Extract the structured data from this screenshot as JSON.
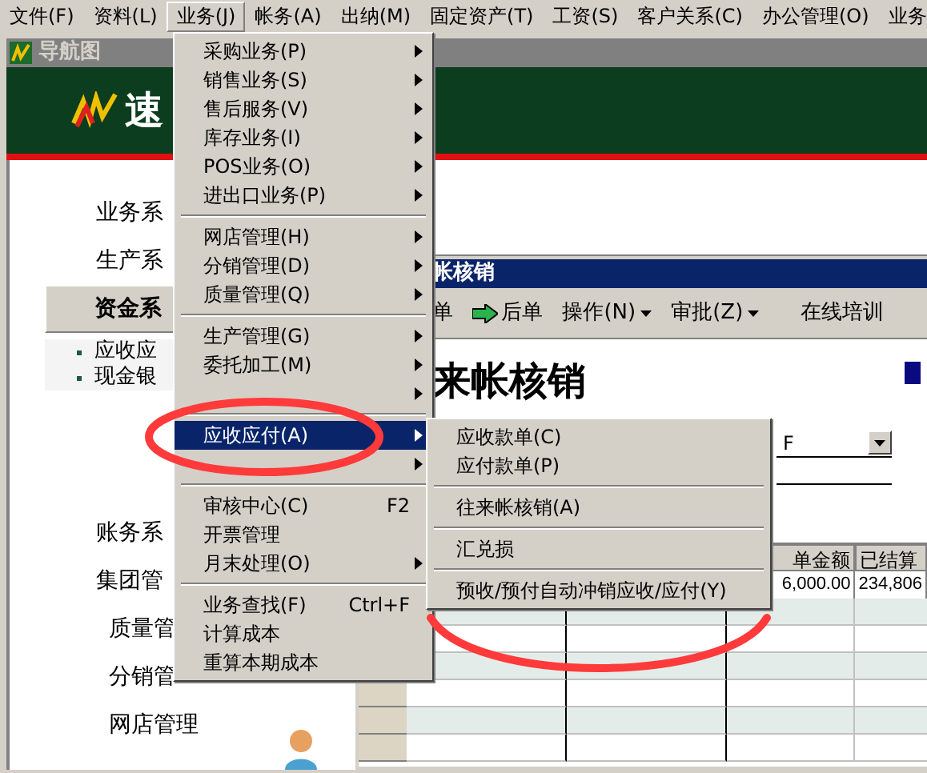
{
  "menubar": [
    {
      "label": "文件(F)",
      "selected": false
    },
    {
      "label": "资料(L)",
      "selected": false
    },
    {
      "label": "业务(J)",
      "selected": true
    },
    {
      "label": "帐务(A)",
      "selected": false
    },
    {
      "label": "出纳(M)",
      "selected": false
    },
    {
      "label": "固定资产(T)",
      "selected": false
    },
    {
      "label": "工资(S)",
      "selected": false
    },
    {
      "label": "客户关系(C)",
      "selected": false
    },
    {
      "label": "办公管理(O)",
      "selected": false
    },
    {
      "label": "业务",
      "selected": false
    }
  ],
  "nav_window": {
    "title": "导航图",
    "logo_text": "速",
    "items": [
      {
        "kind": "system",
        "label": "业务系",
        "selected": false
      },
      {
        "kind": "system",
        "label": "生产系",
        "selected": false
      },
      {
        "kind": "system",
        "label": "资金系",
        "selected": true
      },
      {
        "kind": "link",
        "label": "应收应"
      },
      {
        "kind": "link",
        "label": "现金银"
      },
      {
        "kind": "system",
        "label": "账务系",
        "selected": false
      },
      {
        "kind": "system",
        "label": "集团管",
        "selected": false
      },
      {
        "kind": "module",
        "label": "质量管"
      },
      {
        "kind": "module",
        "label": "分销管"
      },
      {
        "kind": "module",
        "label": "网店管理"
      }
    ]
  },
  "document_window": {
    "title": "帐核销",
    "heading": "来帐核销",
    "toolbar": [
      {
        "kind": "plain",
        "label": "单"
      },
      {
        "kind": "arrow",
        "label": "后单"
      },
      {
        "kind": "dropdown",
        "label": "操作(N)"
      },
      {
        "kind": "dropdown",
        "label": "审批(Z)"
      },
      {
        "kind": "plain",
        "label": "在线培训"
      }
    ],
    "field_value": "F",
    "table": {
      "columns": [
        "单金额",
        "已结算"
      ],
      "rows": [
        [
          "6,000.00",
          "234,806"
        ]
      ]
    }
  },
  "menu": [
    {
      "kind": "item",
      "label": "采购业务(P)",
      "submenu": true,
      "selected": false
    },
    {
      "kind": "item",
      "label": "销售业务(S)",
      "submenu": true,
      "selected": false
    },
    {
      "kind": "item",
      "label": "售后服务(V)",
      "submenu": true,
      "selected": false
    },
    {
      "kind": "item",
      "label": "库存业务(I)",
      "submenu": true,
      "selected": false
    },
    {
      "kind": "item",
      "label": "POS业务(O)",
      "submenu": true,
      "selected": false
    },
    {
      "kind": "item",
      "label": "进出口业务(P)",
      "submenu": true,
      "selected": false
    },
    {
      "kind": "separator"
    },
    {
      "kind": "item",
      "label": "网店管理(H)",
      "submenu": true,
      "selected": false
    },
    {
      "kind": "item",
      "label": "分销管理(D)",
      "submenu": true,
      "selected": false
    },
    {
      "kind": "item",
      "label": "质量管理(Q)",
      "submenu": true,
      "selected": false
    },
    {
      "kind": "separator"
    },
    {
      "kind": "item",
      "label": "生产管理(G)",
      "submenu": true,
      "selected": false
    },
    {
      "kind": "item",
      "label": "委托加工(M)",
      "submenu": true,
      "selected": false
    },
    {
      "kind": "item",
      "submenu": true,
      "selected": false
    },
    {
      "kind": "separator"
    },
    {
      "kind": "item",
      "label": "应收应付(A)",
      "submenu": true,
      "selected": true
    },
    {
      "kind": "item",
      "submenu": true,
      "selected": false
    },
    {
      "kind": "separator"
    },
    {
      "kind": "item",
      "label": "审核中心(C)",
      "shortcut": "F2",
      "submenu": false,
      "selected": false
    },
    {
      "kind": "item",
      "label": "开票管理",
      "submenu": false,
      "selected": false
    },
    {
      "kind": "item",
      "label": "月末处理(O)",
      "submenu": true,
      "selected": false
    },
    {
      "kind": "separator"
    },
    {
      "kind": "item",
      "label": "业务查找(F)",
      "shortcut": "Ctrl+F",
      "submenu": false,
      "selected": false
    },
    {
      "kind": "item",
      "label": "计算成本",
      "submenu": false,
      "selected": false
    },
    {
      "kind": "item",
      "label": "重算本期成本",
      "submenu": false,
      "selected": false
    }
  ],
  "submenu": [
    {
      "kind": "item",
      "label": "应收款单(C)",
      "selected": false
    },
    {
      "kind": "item",
      "label": "应付款单(P)",
      "selected": false
    },
    {
      "kind": "separator"
    },
    {
      "kind": "item",
      "label": "往来帐核销(A)",
      "selected": false
    },
    {
      "kind": "separator"
    },
    {
      "kind": "item",
      "label": "汇兑损",
      "selected": false
    },
    {
      "kind": "separator"
    },
    {
      "kind": "item",
      "label": "预收/预付自动冲销应收/应付(Y)",
      "selected": false
    }
  ]
}
